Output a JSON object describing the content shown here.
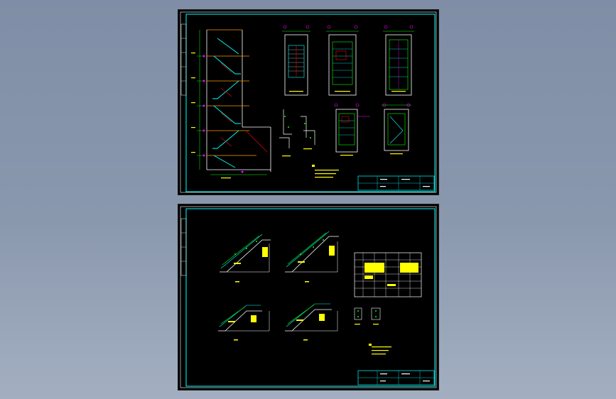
{
  "viewer": {
    "background_top": "#7f8ea6",
    "background_bottom": "#a3afc1"
  },
  "colors": {
    "frame": "#00ffff",
    "linework": "#ffffff",
    "text": "#ffff00",
    "rebar": "#00ff00",
    "dimension": "#ff00ff",
    "section": "#ff0000",
    "accent": "#ff9900"
  },
  "sheets": [
    {
      "id": "sheet-top",
      "content": "stair-section-and-plans"
    },
    {
      "id": "sheet-bottom",
      "content": "stair-flight-reinforcement"
    }
  ]
}
